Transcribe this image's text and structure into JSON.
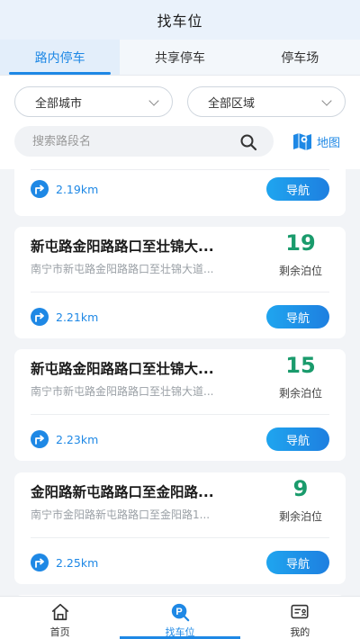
{
  "header": {
    "title": "找车位"
  },
  "tabs": [
    {
      "label": "路内停车",
      "active": true
    },
    {
      "label": "共享停车",
      "active": false
    },
    {
      "label": "停车场",
      "active": false
    }
  ],
  "filters": {
    "city": "全部城市",
    "area": "全部区域",
    "search_placeholder": "搜索路段名",
    "map_label": "地图"
  },
  "nav_label": "导航",
  "count_label": "剩余泊位",
  "items": [
    {
      "title": "",
      "subtitle": "",
      "count": "",
      "distance": "2.19km"
    },
    {
      "title": "新屯路金阳路路口至壮锦大...",
      "subtitle": "南宁市新屯路金阳路路口至壮锦大道...",
      "count": "19",
      "distance": "2.21km"
    },
    {
      "title": "新屯路金阳路路口至壮锦大...",
      "subtitle": "南宁市新屯路金阳路路口至壮锦大道...",
      "count": "15",
      "distance": "2.23km"
    },
    {
      "title": "金阳路新屯路路口至金阳路...",
      "subtitle": "南宁市金阳路新屯路路口至金阳路1...",
      "count": "9",
      "distance": "2.25km"
    }
  ],
  "tabbar": [
    {
      "label": "首页",
      "icon": "home-icon"
    },
    {
      "label": "找车位",
      "icon": "parking-icon"
    },
    {
      "label": "我的",
      "icon": "profile-card-icon"
    }
  ],
  "colors": {
    "accent": "#1e88e5",
    "count": "#1a9b6c"
  }
}
